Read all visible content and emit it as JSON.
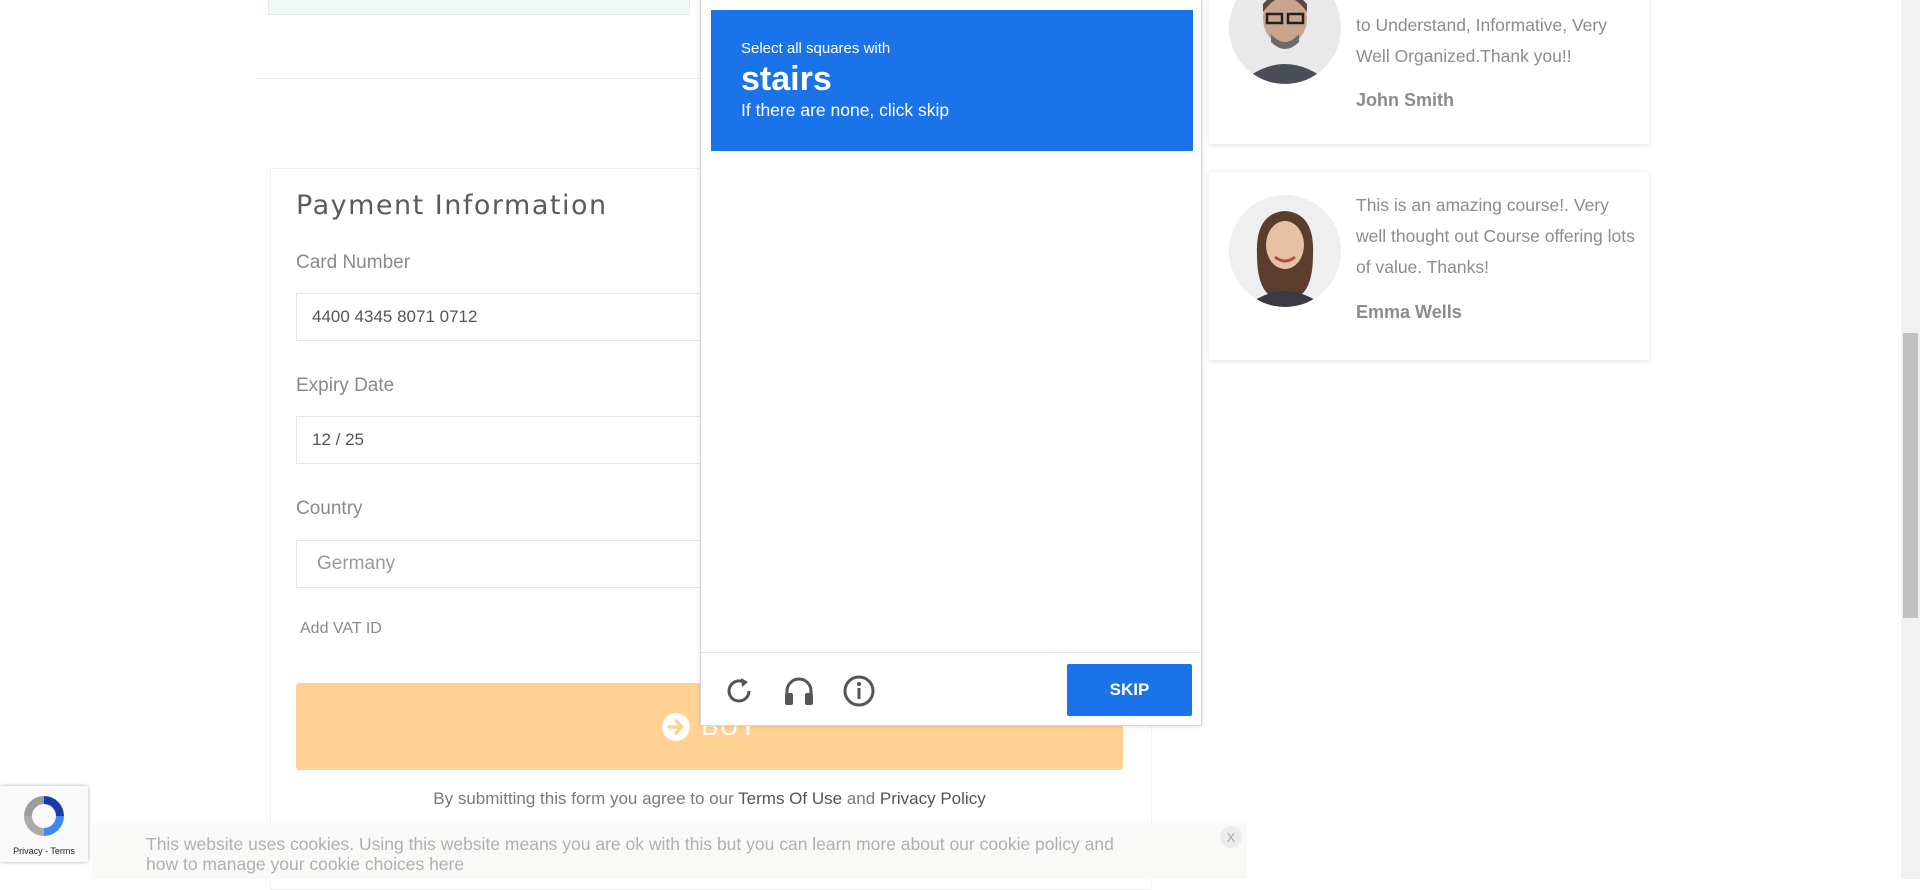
{
  "payment": {
    "title": "Payment Information",
    "card_number_label": "Card Number",
    "card_number_value": "4400 4345 8071 0712",
    "expiry_label": "Expiry Date",
    "expiry_value": "12 / 25",
    "country_label": "Country",
    "country_value": "Germany",
    "vat_link": "Add VAT ID",
    "buy_label": "BUY",
    "terms_prefix": "By submitting this form you agree to our ",
    "terms_link": "Terms Of Use",
    "terms_and": " and ",
    "privacy_link": "Privacy Policy",
    "buy_color": "#ffd293"
  },
  "captcha": {
    "instruction_small": "Select all squares with",
    "target_word": "stairs",
    "instruction_sub": "If there are none, click skip",
    "skip_label": "SKIP",
    "accent": "#1a73e8",
    "icons": [
      "reload-icon",
      "headphones-icon",
      "info-icon"
    ]
  },
  "testimonials": [
    {
      "text": "to Understand, Informative, Very Well Organized.Thank you!!",
      "name": "John Smith"
    },
    {
      "text": "This is an amazing course!. Very well thought out Course offering lots of value. Thanks!",
      "name": "Emma Wells"
    }
  ],
  "recaptcha_badge": {
    "links": "Privacy - Terms"
  },
  "cookie": {
    "text": "This website uses cookies. Using this website means you are ok with this but you can learn more about our cookie policy and how to manage your cookie choices here",
    "close": "X"
  }
}
